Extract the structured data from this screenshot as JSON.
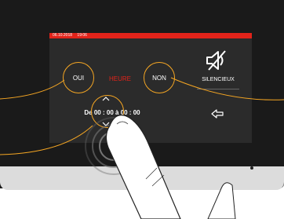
{
  "status_bar": {
    "date": "06.10.2018",
    "time": "19:06"
  },
  "buttons": {
    "oui": "OUI",
    "non": "NON"
  },
  "schedule": {
    "label": "HEURE",
    "prefix": "De",
    "start": "00 : 00",
    "sep": "à",
    "end": "00 : 00"
  },
  "silent": {
    "label": "SILENCIEUX",
    "icon": "speaker-muted-icon"
  },
  "icons": {
    "back": "back-arrow-icon",
    "up": "chevron-up-icon",
    "down": "chevron-down-icon"
  },
  "colors": {
    "accent": "#e2231a",
    "highlight": "#f5a623",
    "screen": "#2b2b2b"
  }
}
